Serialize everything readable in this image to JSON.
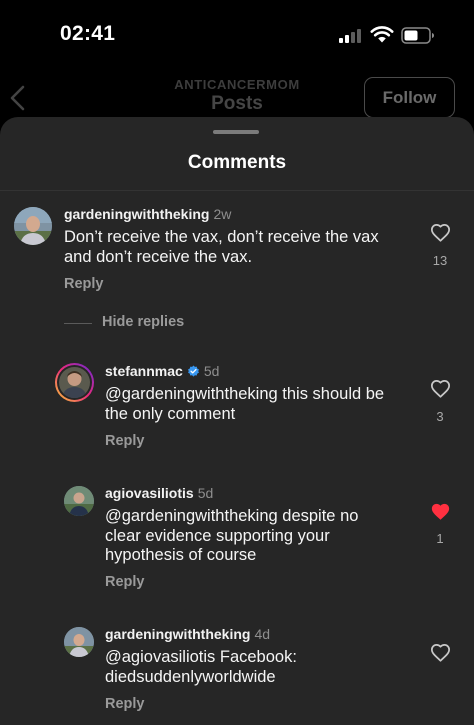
{
  "status_bar": {
    "time": "02:41"
  },
  "header": {
    "username": "ANTICANCERMOM",
    "title": "Posts",
    "follow_label": "Follow"
  },
  "sheet": {
    "title": "Comments"
  },
  "comments": [
    {
      "username": "gardeningwiththeking",
      "time": "2w",
      "text_lines": [
        "Don’t receive the vax, don’t receive the vax",
        "and don’t receive the vax."
      ],
      "reply_label": "Reply",
      "likes": "13",
      "liked": false
    }
  ],
  "hide_replies_label": "Hide replies",
  "replies": [
    {
      "username": "stefannmac",
      "verified": true,
      "time": "5d",
      "text_lines": [
        "@gardeningwiththeking this should be",
        "the only comment"
      ],
      "reply_label": "Reply",
      "likes": "3",
      "liked": false
    },
    {
      "username": "agiovasiliotis",
      "verified": false,
      "time": "5d",
      "text_lines": [
        "@gardeningwiththeking despite no",
        "clear evidence supporting your",
        "hypothesis of course"
      ],
      "reply_label": "Reply",
      "likes": "1",
      "liked": true
    },
    {
      "username": "gardeningwiththeking",
      "verified": false,
      "time": "4d",
      "text_lines": [
        "@agiovasiliotis Facebook:",
        "diedsuddenlyworldwide"
      ],
      "reply_label": "Reply",
      "likes": "",
      "liked": false
    }
  ],
  "colors": {
    "like_active": "#ff3040",
    "verified_badge": "#3897f0",
    "sheet_bg": "#262626"
  },
  "icons": {
    "back": "chevron-left-icon",
    "like": "heart-outline-icon",
    "liked": "heart-filled-icon",
    "verified": "verified-badge-icon"
  }
}
